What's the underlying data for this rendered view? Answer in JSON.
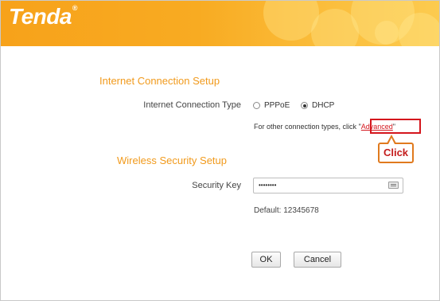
{
  "header": {
    "logo_text": "Tenda",
    "logo_mark": "®"
  },
  "internet": {
    "section_title": "Internet Connection Setup",
    "type_label": "Internet Connection Type",
    "options": [
      {
        "label": "PPPoE",
        "checked": false
      },
      {
        "label": "DHCP",
        "checked": true
      }
    ],
    "hint_prefix": "For other connection types, click ",
    "hint_quote_open": "\"",
    "advanced_link": "Advanced",
    "hint_quote_close": "\""
  },
  "callout": {
    "text": "Click"
  },
  "wireless": {
    "section_title": "Wireless Security Setup",
    "key_label": "Security Key",
    "key_value": "••••••••",
    "default_text": "Default: 12345678"
  },
  "buttons": {
    "ok": "OK",
    "cancel": "Cancel"
  },
  "colors": {
    "header": "#f7a21a",
    "section_title": "#f19a1c",
    "highlight": "#d4161d"
  }
}
